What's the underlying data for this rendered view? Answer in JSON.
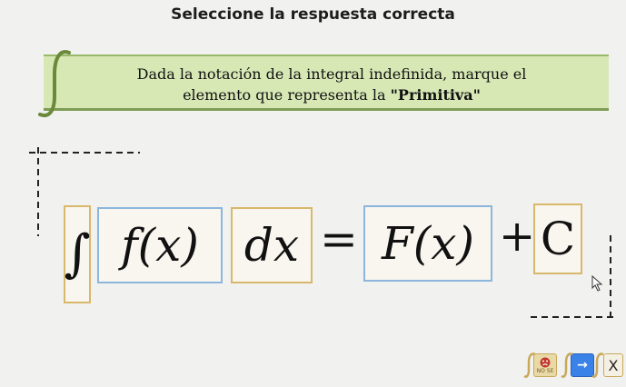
{
  "header": {
    "title": "Seleccione la respuesta correcta"
  },
  "instruction": {
    "line1": "Dada la notación de la integral indefinida, marque el",
    "line2_prefix": "elemento que representa la ",
    "line2_emphasis": "\"Primitiva\""
  },
  "equation": {
    "integral_sign": "∫",
    "integrand": "f(x)",
    "differential": "dx",
    "equals": "=",
    "primitive": "F(x)",
    "plus": "+",
    "constant": "C"
  },
  "footer": {
    "sad_label": "NO SE",
    "next_glyph": "→",
    "close_glyph": "X"
  },
  "colors": {
    "background": "#f1f1f0",
    "banner": "#d7e8b5",
    "yellow_border": "#d8b86a",
    "blue_border": "#8cb6dc",
    "next_button": "#3b82e8"
  }
}
